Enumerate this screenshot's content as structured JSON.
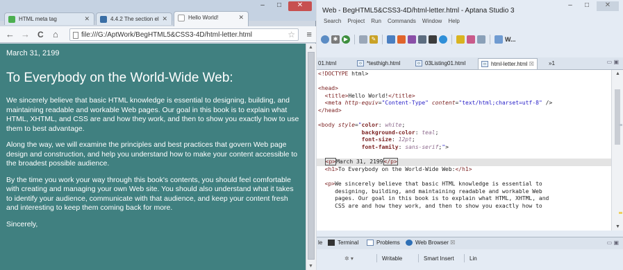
{
  "chrome": {
    "tabs": [
      {
        "title": "HTML meta tag",
        "favicon_color": "#4caf50"
      },
      {
        "title": "4.4.2 The section el",
        "favicon_color": "#3a6ea5"
      },
      {
        "title": "Hello World!",
        "favicon_color": "#ffffff"
      }
    ],
    "window_buttons": {
      "minimize": "–",
      "maximize": "□",
      "close": "✕"
    },
    "address": "file:///G:/AptWork/BegHTML5&CSS3-4D/html-letter.html",
    "nav": {
      "back": "←",
      "forward": "→",
      "reload": "C",
      "home": "⌂",
      "star": "☆",
      "menu": "≡"
    }
  },
  "page": {
    "background": "#408080",
    "date": "March 31, 2199",
    "heading": "To Everybody on the World-Wide Web:",
    "paragraphs": [
      "We sincerely believe that basic HTML knowledge is essential to designing, building, and maintaining readable and workable Web pages. Our goal in this book is to explain what HTML, XHTML, and CSS are and how they work, and then to show you exactly how to use them to best advantage.",
      "Along the way, we will examine the principles and best practices that govern Web page design and construction, and help you understand how to make your content accessible to the broadest possible audience.",
      "By the time you work your way through this book's contents, you should feel comfortable with creating and managing your own Web site. You should also understand what it takes to identify your audience, communicate with that audience, and keep your content fresh and interesting to keep them coming back for more."
    ],
    "closing": "Sincerely,"
  },
  "aptana": {
    "title": "Web - BegHTML5&CSS3-4D/html-letter.html - Aptana Studio 3",
    "menu": [
      "Search",
      "Project",
      "Run",
      "Commands",
      "Window",
      "Help"
    ],
    "toolbar_label": "W...",
    "editor_tabs": [
      "01.html",
      "*testhigh.html",
      "03Listing01.html",
      "html-letter.html",
      "»1"
    ],
    "code_lines": [
      "<!DOCTYPE html>",
      "",
      "<head>",
      "  <title>Hello World!</title>",
      "  <meta http-equiv=\"Content-Type\" content=\"text/html;charset=utf-8\" />",
      "</head>",
      "",
      "<body style=\"color: white;",
      "             background-color: teal;",
      "             font-size: 12pt;",
      "             font-family: sans-serif;\">",
      "",
      "  <p>March 31, 2199</p>",
      "  <h1>To Everybody on the World-Wide Web:</h1>",
      "",
      "  <p>We sincerely believe that basic HTML knowledge is essential to",
      "     designing, building, and maintaining readable and workable Web",
      "     pages. Our goal in this book is to explain what HTML, XHTML, and",
      "     CSS are and how they work, and then to show you exactly how to"
    ],
    "bottom_tabs": [
      "le",
      "Terminal",
      "Problems",
      "Web Browser"
    ],
    "status": {
      "mode": "Writable",
      "insert": "Smart Insert",
      "line": "Lin"
    }
  }
}
